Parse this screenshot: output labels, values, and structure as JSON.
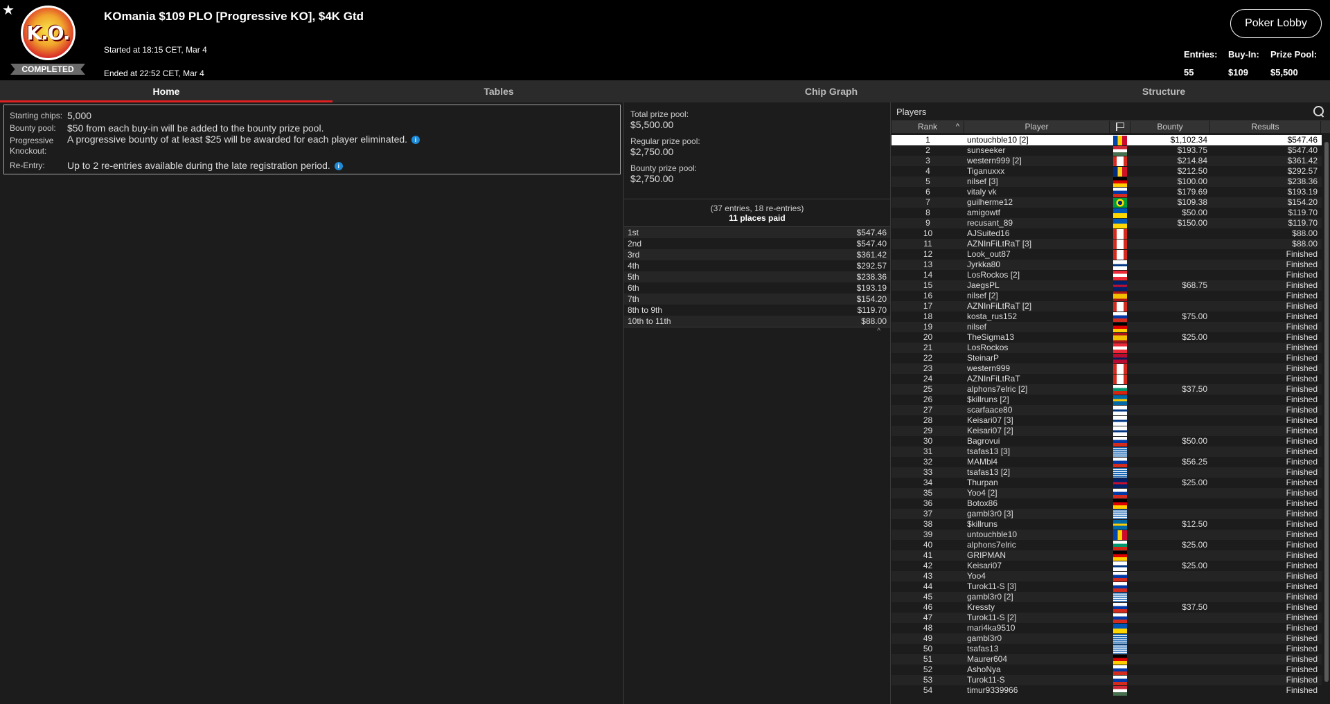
{
  "header": {
    "logo_text": "K.O.",
    "status": "COMPLETED",
    "title": "KOmania $109 PLO [Progressive KO], $4K Gtd",
    "started": "Started at 18:15 CET, Mar 4",
    "ended": "Ended at 22:52 CET, Mar 4",
    "lobby_button": "Poker Lobby",
    "entries_label": "Entries:",
    "entries_value": "55",
    "buyin_label": "Buy-In:",
    "buyin_value": "$109",
    "prizepool_label": "Prize Pool:",
    "prizepool_value": "$5,500"
  },
  "tabs": [
    "Home",
    "Tables",
    "Chip Graph",
    "Structure"
  ],
  "info": {
    "starting_chips_label": "Starting chips:",
    "starting_chips_value": "5,000",
    "bounty_pool_label": "Bounty pool:",
    "bounty_pool_value": "$50 from each buy-in will be added to the bounty prize pool.",
    "pko_label": "Progressive Knockout:",
    "pko_value": "A progressive bounty of at least $25 will be awarded for each player eliminated.",
    "reentry_label": "Re-Entry:",
    "reentry_value": "Up to 2 re-entries available during the late registration period."
  },
  "pools": {
    "total_label": "Total prize pool:",
    "total_value": "$5,500.00",
    "regular_label": "Regular prize pool:",
    "regular_value": "$2,750.00",
    "bounty_label": "Bounty prize pool:",
    "bounty_value": "$2,750.00",
    "entries_text": "(37 entries, 18 re-entries)",
    "places_paid": "11 places paid"
  },
  "payouts": [
    {
      "place": "1st",
      "amount": "$547.46"
    },
    {
      "place": "2nd",
      "amount": "$547.40"
    },
    {
      "place": "3rd",
      "amount": "$361.42"
    },
    {
      "place": "4th",
      "amount": "$292.57"
    },
    {
      "place": "5th",
      "amount": "$238.36"
    },
    {
      "place": "6th",
      "amount": "$193.19"
    },
    {
      "place": "7th",
      "amount": "$154.20"
    },
    {
      "place": "8th to 9th",
      "amount": "$119.70"
    },
    {
      "place": "10th to 11th",
      "amount": "$88.00"
    }
  ],
  "players_panel": {
    "title": "Players",
    "col_rank": "Rank",
    "col_player": "Player",
    "col_bounty": "Bounty",
    "col_results": "Results"
  },
  "players": [
    {
      "rank": "1",
      "name": "untouchble10 [2]",
      "flag": "md",
      "bounty": "$1,102.34",
      "result": "$547.46"
    },
    {
      "rank": "2",
      "name": "sunseeker",
      "flag": "hu",
      "bounty": "$193.75",
      "result": "$547.40"
    },
    {
      "rank": "3",
      "name": "western999 [2]",
      "flag": "ca",
      "bounty": "$214.84",
      "result": "$361.42"
    },
    {
      "rank": "4",
      "name": "Tiganuxxx",
      "flag": "ro",
      "bounty": "$212.50",
      "result": "$292.57"
    },
    {
      "rank": "5",
      "name": "nilsef [3]",
      "flag": "de",
      "bounty": "$100.00",
      "result": "$238.36"
    },
    {
      "rank": "6",
      "name": "vitaly vk",
      "flag": "ru",
      "bounty": "$179.69",
      "result": "$193.19"
    },
    {
      "rank": "7",
      "name": "guilherme12",
      "flag": "br",
      "bounty": "$109.38",
      "result": "$154.20"
    },
    {
      "rank": "8",
      "name": "amigowtf",
      "flag": "ua",
      "bounty": "$50.00",
      "result": "$119.70"
    },
    {
      "rank": "9",
      "name": "recusant_89",
      "flag": "ua",
      "bounty": "$150.00",
      "result": "$119.70"
    },
    {
      "rank": "10",
      "name": "AJSuited16",
      "flag": "ca",
      "bounty": "",
      "result": "$88.00"
    },
    {
      "rank": "11",
      "name": "AZNInFiLtRaT [3]",
      "flag": "ca",
      "bounty": "",
      "result": "$88.00"
    },
    {
      "rank": "12",
      "name": "Look_out87",
      "flag": "ca",
      "bounty": "",
      "result": "Finished"
    },
    {
      "rank": "13",
      "name": "Jyrkka80",
      "flag": "fi",
      "bounty": "",
      "result": "Finished"
    },
    {
      "rank": "14",
      "name": "LosRockos [2]",
      "flag": "at",
      "bounty": "",
      "result": "Finished"
    },
    {
      "rank": "15",
      "name": "JaegsPL",
      "flag": "gb",
      "bounty": "$68.75",
      "result": "Finished"
    },
    {
      "rank": "16",
      "name": "nilsef [2]",
      "flag": "es",
      "bounty": "",
      "result": "Finished"
    },
    {
      "rank": "17",
      "name": "AZNInFiLtRaT [2]",
      "flag": "ca",
      "bounty": "",
      "result": "Finished"
    },
    {
      "rank": "18",
      "name": "kosta_rus152",
      "flag": "ru",
      "bounty": "$75.00",
      "result": "Finished"
    },
    {
      "rank": "19",
      "name": "nilsef",
      "flag": "de",
      "bounty": "",
      "result": "Finished"
    },
    {
      "rank": "20",
      "name": "TheSigma13",
      "flag": "es",
      "bounty": "$25.00",
      "result": "Finished"
    },
    {
      "rank": "21",
      "name": "LosRockos",
      "flag": "at",
      "bounty": "",
      "result": "Finished"
    },
    {
      "rank": "22",
      "name": "SteinarP",
      "flag": "no",
      "bounty": "",
      "result": "Finished"
    },
    {
      "rank": "23",
      "name": "western999",
      "flag": "ca",
      "bounty": "",
      "result": "Finished"
    },
    {
      "rank": "24",
      "name": "AZNInFiLtRaT",
      "flag": "ca",
      "bounty": "",
      "result": "Finished"
    },
    {
      "rank": "25",
      "name": "alphons7elric [2]",
      "flag": "bg",
      "bounty": "$37.50",
      "result": "Finished"
    },
    {
      "rank": "26",
      "name": "$killruns [2]",
      "flag": "se",
      "bounty": "",
      "result": "Finished"
    },
    {
      "rank": "27",
      "name": "scarfaace80",
      "flag": "fi",
      "bounty": "",
      "result": "Finished"
    },
    {
      "rank": "28",
      "name": "Keisari07 [3]",
      "flag": "fi",
      "bounty": "",
      "result": "Finished"
    },
    {
      "rank": "29",
      "name": "Keisari07 [2]",
      "flag": "fi",
      "bounty": "",
      "result": "Finished"
    },
    {
      "rank": "30",
      "name": "Bagrovui",
      "flag": "ru",
      "bounty": "$50.00",
      "result": "Finished"
    },
    {
      "rank": "31",
      "name": "tsafas13 [3]",
      "flag": "gr",
      "bounty": "",
      "result": "Finished"
    },
    {
      "rank": "32",
      "name": "MAMbl4",
      "flag": "ru",
      "bounty": "$56.25",
      "result": "Finished"
    },
    {
      "rank": "33",
      "name": "tsafas13 [2]",
      "flag": "gr",
      "bounty": "",
      "result": "Finished"
    },
    {
      "rank": "34",
      "name": "Thurpan",
      "flag": "gb",
      "bounty": "$25.00",
      "result": "Finished"
    },
    {
      "rank": "35",
      "name": "Yoo4 [2]",
      "flag": "ru",
      "bounty": "",
      "result": "Finished"
    },
    {
      "rank": "36",
      "name": "Botox86",
      "flag": "de",
      "bounty": "",
      "result": "Finished"
    },
    {
      "rank": "37",
      "name": "gambl3r0 [3]",
      "flag": "gr",
      "bounty": "",
      "result": "Finished"
    },
    {
      "rank": "38",
      "name": "$killruns",
      "flag": "se",
      "bounty": "$12.50",
      "result": "Finished"
    },
    {
      "rank": "39",
      "name": "untouchble10",
      "flag": "md",
      "bounty": "",
      "result": "Finished"
    },
    {
      "rank": "40",
      "name": "alphons7elric",
      "flag": "bg",
      "bounty": "$25.00",
      "result": "Finished"
    },
    {
      "rank": "41",
      "name": "GRIPMAN",
      "flag": "de",
      "bounty": "",
      "result": "Finished"
    },
    {
      "rank": "42",
      "name": "Keisari07",
      "flag": "fi",
      "bounty": "$25.00",
      "result": "Finished"
    },
    {
      "rank": "43",
      "name": "Yoo4",
      "flag": "ru",
      "bounty": "",
      "result": "Finished"
    },
    {
      "rank": "44",
      "name": "Turok11-S [3]",
      "flag": "ru",
      "bounty": "",
      "result": "Finished"
    },
    {
      "rank": "45",
      "name": "gambl3r0 [2]",
      "flag": "gr",
      "bounty": "",
      "result": "Finished"
    },
    {
      "rank": "46",
      "name": "Kressty",
      "flag": "ru",
      "bounty": "$37.50",
      "result": "Finished"
    },
    {
      "rank": "47",
      "name": "Turok11-S [2]",
      "flag": "ru",
      "bounty": "",
      "result": "Finished"
    },
    {
      "rank": "48",
      "name": "mari4ka9510",
      "flag": "ua",
      "bounty": "",
      "result": "Finished"
    },
    {
      "rank": "49",
      "name": "gambl3r0",
      "flag": "gr",
      "bounty": "",
      "result": "Finished"
    },
    {
      "rank": "50",
      "name": "tsafas13",
      "flag": "gr",
      "bounty": "",
      "result": "Finished"
    },
    {
      "rank": "51",
      "name": "Maurer604",
      "flag": "de",
      "bounty": "",
      "result": "Finished"
    },
    {
      "rank": "52",
      "name": "AshoNya",
      "flag": "ru",
      "bounty": "",
      "result": "Finished"
    },
    {
      "rank": "53",
      "name": "Turok11-S",
      "flag": "ru",
      "bounty": "",
      "result": "Finished"
    },
    {
      "rank": "54",
      "name": "timur9339966",
      "flag": "hu",
      "bounty": "",
      "result": "Finished"
    }
  ]
}
